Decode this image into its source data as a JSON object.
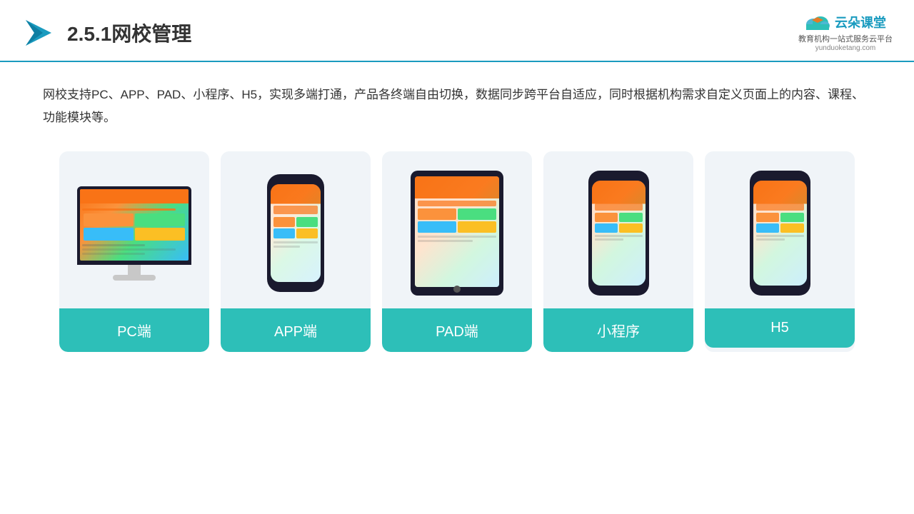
{
  "header": {
    "title": "2.5.1网校管理",
    "logo_main": "云朵课堂",
    "logo_url": "yunduoketang.com",
    "logo_tagline": "教育机构一站\n式服务云平台"
  },
  "description": {
    "text": "网校支持PC、APP、PAD、小程序、H5，实现多端打通，产品各终端自由切换，数据同步跨平台自适应，同时根据机构需求自定义页面上的内容、课程、功能模块等。"
  },
  "cards": [
    {
      "id": "pc",
      "label": "PC端"
    },
    {
      "id": "app",
      "label": "APP端"
    },
    {
      "id": "pad",
      "label": "PAD端"
    },
    {
      "id": "miniapp",
      "label": "小程序"
    },
    {
      "id": "h5",
      "label": "H5"
    }
  ]
}
